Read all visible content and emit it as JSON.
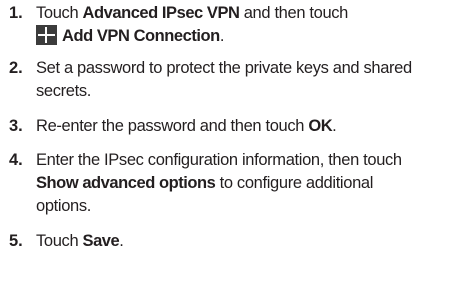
{
  "steps": [
    {
      "number": "1.",
      "parts": [
        "Touch ",
        "Advanced IPsec VPN",
        " and then touch",
        "Add VPN Connection",
        "."
      ],
      "icon": "plus-icon"
    },
    {
      "number": "2.",
      "line1": "Set a password to protect the private keys and shared",
      "line2": "secrets."
    },
    {
      "number": "3.",
      "parts": [
        "Re-enter the password and then touch ",
        "OK",
        "."
      ]
    },
    {
      "number": "4.",
      "line1": "Enter the IPsec configuration information, then touch",
      "bold": "Show advanced options",
      "line2_rest": " to configure additional",
      "line3": "options."
    },
    {
      "number": "5.",
      "parts": [
        "Touch ",
        "Save",
        "."
      ]
    }
  ]
}
